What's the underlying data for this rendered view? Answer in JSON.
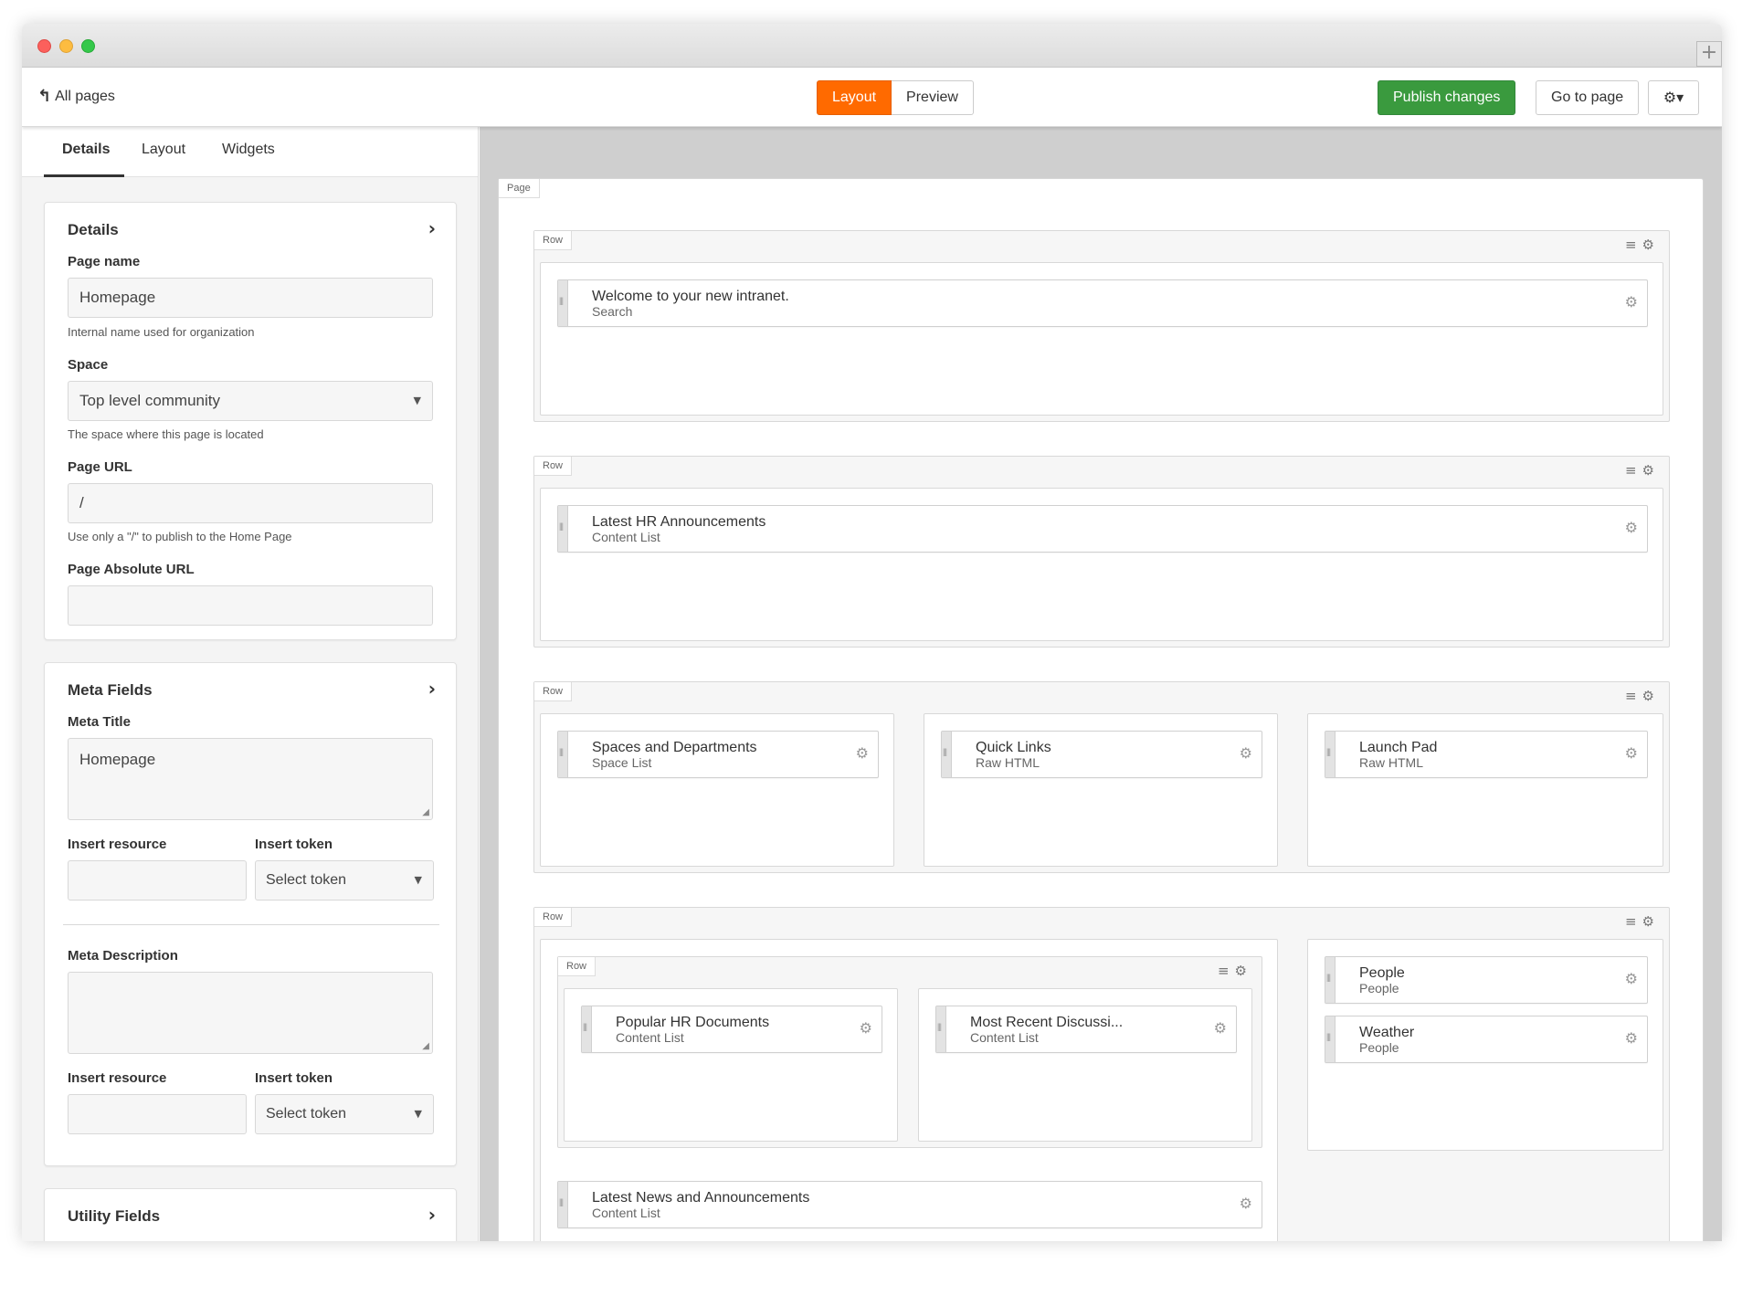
{
  "toolbar": {
    "back_label": "All pages",
    "layout_label": "Layout",
    "preview_label": "Preview",
    "publish_label": "Publish changes",
    "goto_label": "Go to page",
    "settings_icon": "gear-dropdown-icon"
  },
  "colors": {
    "accent": "#ff6a00",
    "publish": "#3a9a3e"
  },
  "sidebar": {
    "tabs": [
      "Details",
      "Layout",
      "Widgets"
    ],
    "details": {
      "title": "Details",
      "page_name_label": "Page name",
      "page_name_value": "Homepage",
      "page_name_help": "Internal name used for organization",
      "space_label": "Space",
      "space_value": "Top level community",
      "space_help": "The space where this page is located",
      "url_label": "Page URL",
      "url_value": "/",
      "url_help": "Use only a \"/\" to publish to the Home Page",
      "abs_url_label": "Page Absolute URL",
      "abs_url_value": ""
    },
    "meta": {
      "title": "Meta Fields",
      "meta_title_label": "Meta Title",
      "meta_title_value": "Homepage",
      "insert_resource_label": "Insert resource",
      "insert_token_label": "Insert token",
      "token_placeholder": "Select token",
      "meta_desc_label": "Meta Description",
      "meta_desc_value": "",
      "insert_resource_label_2": "Insert resource",
      "insert_token_label_2": "Insert token",
      "token_placeholder_2": "Select token"
    },
    "utility": {
      "title": "Utility Fields"
    }
  },
  "canvas": {
    "page_tag": "Page",
    "row_tag": "Row",
    "rows": [
      {
        "widgets": [
          {
            "title": "Welcome to your new intranet.",
            "type": "Search"
          }
        ]
      },
      {
        "widgets": [
          {
            "title": "Latest HR Announcements",
            "type": "Content List"
          }
        ]
      },
      {
        "widgets": [
          {
            "title": "Spaces and Departments",
            "type": "Space List"
          },
          {
            "title": "Quick Links",
            "type": "Raw HTML"
          },
          {
            "title": "Launch Pad",
            "type": "Raw HTML"
          }
        ]
      },
      {
        "nested_widgets": [
          {
            "title": "Popular HR Documents",
            "type": "Content List"
          },
          {
            "title": "Most Recent Discussi...",
            "type": "Content List"
          }
        ],
        "bottom_widget": {
          "title": "Latest News and Announcements",
          "type": "Content List"
        },
        "side_widgets": [
          {
            "title": "People",
            "type": "People"
          },
          {
            "title": "Weather",
            "type": "People"
          }
        ]
      }
    ]
  }
}
